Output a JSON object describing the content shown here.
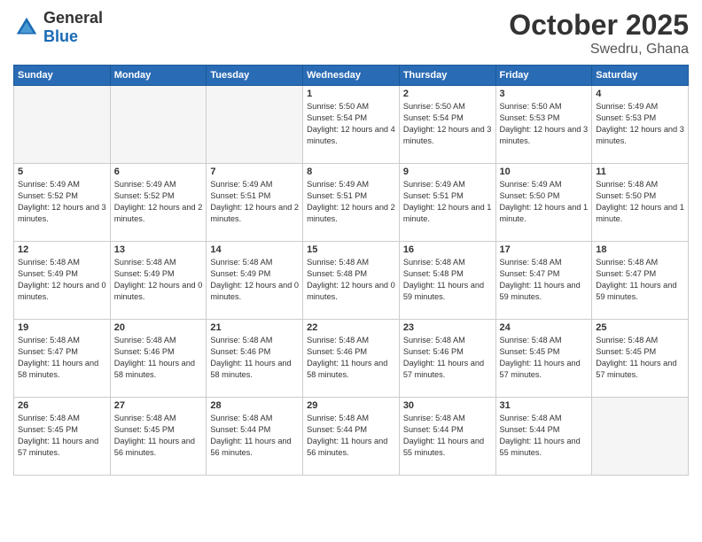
{
  "header": {
    "logo_general": "General",
    "logo_blue": "Blue",
    "month": "October 2025",
    "location": "Swedru, Ghana"
  },
  "days_of_week": [
    "Sunday",
    "Monday",
    "Tuesday",
    "Wednesday",
    "Thursday",
    "Friday",
    "Saturday"
  ],
  "weeks": [
    [
      {
        "day": "",
        "empty": true
      },
      {
        "day": "",
        "empty": true
      },
      {
        "day": "",
        "empty": true
      },
      {
        "day": "1",
        "sunrise": "5:50 AM",
        "sunset": "5:54 PM",
        "daylight": "12 hours and 4 minutes."
      },
      {
        "day": "2",
        "sunrise": "5:50 AM",
        "sunset": "5:54 PM",
        "daylight": "12 hours and 3 minutes."
      },
      {
        "day": "3",
        "sunrise": "5:50 AM",
        "sunset": "5:53 PM",
        "daylight": "12 hours and 3 minutes."
      },
      {
        "day": "4",
        "sunrise": "5:49 AM",
        "sunset": "5:53 PM",
        "daylight": "12 hours and 3 minutes."
      }
    ],
    [
      {
        "day": "5",
        "sunrise": "5:49 AM",
        "sunset": "5:52 PM",
        "daylight": "12 hours and 3 minutes."
      },
      {
        "day": "6",
        "sunrise": "5:49 AM",
        "sunset": "5:52 PM",
        "daylight": "12 hours and 2 minutes."
      },
      {
        "day": "7",
        "sunrise": "5:49 AM",
        "sunset": "5:51 PM",
        "daylight": "12 hours and 2 minutes."
      },
      {
        "day": "8",
        "sunrise": "5:49 AM",
        "sunset": "5:51 PM",
        "daylight": "12 hours and 2 minutes."
      },
      {
        "day": "9",
        "sunrise": "5:49 AM",
        "sunset": "5:51 PM",
        "daylight": "12 hours and 1 minute."
      },
      {
        "day": "10",
        "sunrise": "5:49 AM",
        "sunset": "5:50 PM",
        "daylight": "12 hours and 1 minute."
      },
      {
        "day": "11",
        "sunrise": "5:48 AM",
        "sunset": "5:50 PM",
        "daylight": "12 hours and 1 minute."
      }
    ],
    [
      {
        "day": "12",
        "sunrise": "5:48 AM",
        "sunset": "5:49 PM",
        "daylight": "12 hours and 0 minutes."
      },
      {
        "day": "13",
        "sunrise": "5:48 AM",
        "sunset": "5:49 PM",
        "daylight": "12 hours and 0 minutes."
      },
      {
        "day": "14",
        "sunrise": "5:48 AM",
        "sunset": "5:49 PM",
        "daylight": "12 hours and 0 minutes."
      },
      {
        "day": "15",
        "sunrise": "5:48 AM",
        "sunset": "5:48 PM",
        "daylight": "12 hours and 0 minutes."
      },
      {
        "day": "16",
        "sunrise": "5:48 AM",
        "sunset": "5:48 PM",
        "daylight": "11 hours and 59 minutes."
      },
      {
        "day": "17",
        "sunrise": "5:48 AM",
        "sunset": "5:47 PM",
        "daylight": "11 hours and 59 minutes."
      },
      {
        "day": "18",
        "sunrise": "5:48 AM",
        "sunset": "5:47 PM",
        "daylight": "11 hours and 59 minutes."
      }
    ],
    [
      {
        "day": "19",
        "sunrise": "5:48 AM",
        "sunset": "5:47 PM",
        "daylight": "11 hours and 58 minutes."
      },
      {
        "day": "20",
        "sunrise": "5:48 AM",
        "sunset": "5:46 PM",
        "daylight": "11 hours and 58 minutes."
      },
      {
        "day": "21",
        "sunrise": "5:48 AM",
        "sunset": "5:46 PM",
        "daylight": "11 hours and 58 minutes."
      },
      {
        "day": "22",
        "sunrise": "5:48 AM",
        "sunset": "5:46 PM",
        "daylight": "11 hours and 58 minutes."
      },
      {
        "day": "23",
        "sunrise": "5:48 AM",
        "sunset": "5:46 PM",
        "daylight": "11 hours and 57 minutes."
      },
      {
        "day": "24",
        "sunrise": "5:48 AM",
        "sunset": "5:45 PM",
        "daylight": "11 hours and 57 minutes."
      },
      {
        "day": "25",
        "sunrise": "5:48 AM",
        "sunset": "5:45 PM",
        "daylight": "11 hours and 57 minutes."
      }
    ],
    [
      {
        "day": "26",
        "sunrise": "5:48 AM",
        "sunset": "5:45 PM",
        "daylight": "11 hours and 57 minutes."
      },
      {
        "day": "27",
        "sunrise": "5:48 AM",
        "sunset": "5:45 PM",
        "daylight": "11 hours and 56 minutes."
      },
      {
        "day": "28",
        "sunrise": "5:48 AM",
        "sunset": "5:44 PM",
        "daylight": "11 hours and 56 minutes."
      },
      {
        "day": "29",
        "sunrise": "5:48 AM",
        "sunset": "5:44 PM",
        "daylight": "11 hours and 56 minutes."
      },
      {
        "day": "30",
        "sunrise": "5:48 AM",
        "sunset": "5:44 PM",
        "daylight": "11 hours and 55 minutes."
      },
      {
        "day": "31",
        "sunrise": "5:48 AM",
        "sunset": "5:44 PM",
        "daylight": "11 hours and 55 minutes."
      },
      {
        "day": "",
        "empty": true
      }
    ]
  ],
  "labels": {
    "sunrise": "Sunrise:",
    "sunset": "Sunset:",
    "daylight": "Daylight:"
  }
}
